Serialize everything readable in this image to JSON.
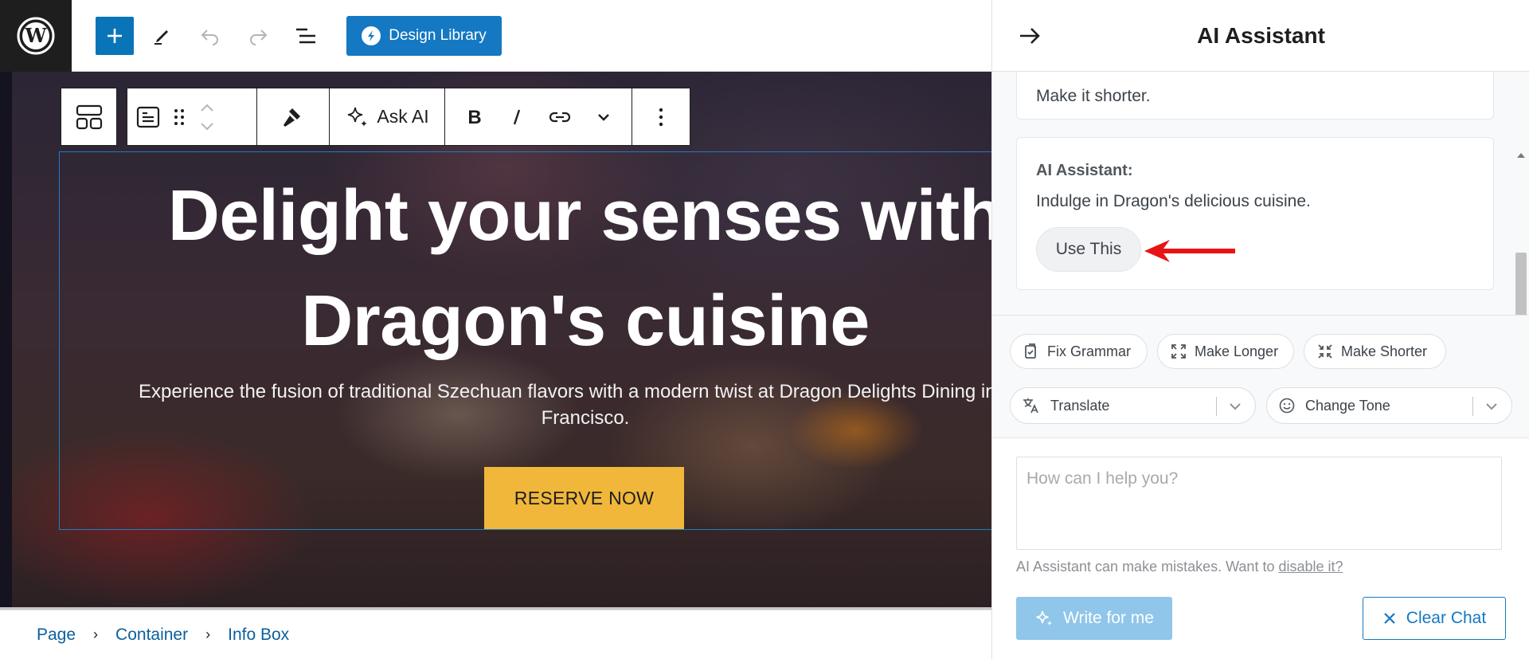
{
  "topbar": {
    "design_library_label": "Design Library"
  },
  "block_toolbar": {
    "ask_ai_label": "Ask AI"
  },
  "hero": {
    "title_line1": "Delight your senses with",
    "title_line2": "Dragon's cuisine",
    "subtitle_line1": "Experience the fusion of traditional Szechuan flavors with a modern twist at Dragon Delights Dining in dov",
    "subtitle_line2": "Francisco.",
    "cta_label": "RESERVE NOW"
  },
  "breadcrumb": {
    "items": [
      "Page",
      "Container",
      "Info Box"
    ]
  },
  "panel": {
    "title": "AI Assistant",
    "messages": {
      "user_text": "Make it shorter.",
      "ai_sender": "AI Assistant:",
      "ai_text": "Indulge in Dragon's delicious cuisine.",
      "use_this_label": "Use This"
    },
    "actions": {
      "fix_grammar": "Fix Grammar",
      "make_longer": "Make Longer",
      "make_shorter": "Make Shorter",
      "translate": "Translate",
      "change_tone": "Change Tone"
    },
    "prompt_placeholder": "How can I help you?",
    "disclaimer_text": "AI Assistant can make mistakes. Want to ",
    "disclaimer_link": "disable it?",
    "write_label": "Write for me",
    "clear_label": "Clear Chat"
  },
  "colors": {
    "accent": "#1478c2",
    "cta": "#f0b73a",
    "write_button": "#8fc6ea",
    "annotation_arrow": "#e81313"
  }
}
